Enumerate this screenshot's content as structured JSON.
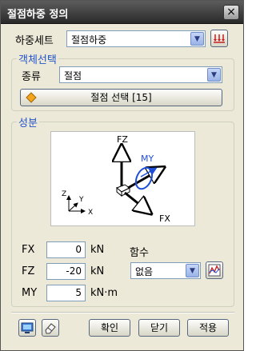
{
  "window": {
    "title": "절점하중 정의",
    "close_glyph": "×"
  },
  "load_set": {
    "label": "하중세트",
    "value": "절점하중"
  },
  "object_selection": {
    "title": "객체선택",
    "type_label": "종류",
    "type_value": "절점",
    "select_button_label": "절점 선택 [15]"
  },
  "components": {
    "title": "성분",
    "diagram": {
      "fz": "FZ",
      "my": "MY",
      "fx": "FX",
      "axis_z": "Z",
      "axis_y": "Y",
      "axis_x": "X"
    },
    "fx": {
      "label": "FX",
      "value": "0",
      "unit": "kN"
    },
    "fz": {
      "label": "FZ",
      "value": "-20",
      "unit": "kN"
    },
    "my": {
      "label": "MY",
      "value": "5",
      "unit": "kN·m"
    },
    "function": {
      "label": "함수",
      "value": "없음"
    }
  },
  "buttons": {
    "ok": "확인",
    "close": "닫기",
    "apply": "적용"
  },
  "colors": {
    "title_bar": "#3a3a3a",
    "group_title": "#2253c9",
    "moment": "#1f4fd8",
    "dialog_bg": "#ece9d8"
  },
  "icons": [
    "load-set-icon",
    "select-node-icon",
    "function-graph-icon",
    "view-icon",
    "eraser-icon"
  ]
}
